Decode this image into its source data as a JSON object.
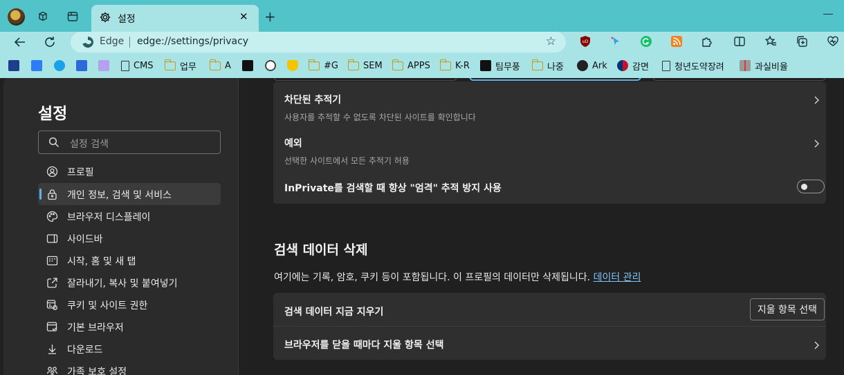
{
  "tab": {
    "title": "설정",
    "close": "✕"
  },
  "newtab": "+",
  "address": {
    "site_label": "Edge",
    "url": "edge://settings/privacy"
  },
  "bookmarks": [
    {
      "label": "CMS",
      "kind": "page"
    },
    {
      "label": "업무",
      "kind": "folder"
    },
    {
      "label": "A",
      "kind": "folder"
    },
    {
      "label": "#G",
      "kind": "folder"
    },
    {
      "label": "SEM",
      "kind": "folder"
    },
    {
      "label": "APPS",
      "kind": "folder"
    },
    {
      "label": "K-R",
      "kind": "folder"
    },
    {
      "label": "팀무풍",
      "kind": "site"
    },
    {
      "label": "나중",
      "kind": "folder"
    },
    {
      "label": "Ark",
      "kind": "site"
    },
    {
      "label": "감면",
      "kind": "site"
    },
    {
      "label": "청년도약장려",
      "kind": "page"
    },
    {
      "label": "과실비율",
      "kind": "site"
    }
  ],
  "sidebar": {
    "title": "설정",
    "search_placeholder": "설정 검색",
    "items": [
      {
        "label": "프로필",
        "icon": "profile-icon"
      },
      {
        "label": "개인 정보, 검색 및 서비스",
        "icon": "lock-icon",
        "active": true
      },
      {
        "label": "브라우저 디스플레이",
        "icon": "palette-icon"
      },
      {
        "label": "사이드바",
        "icon": "sidebar-icon"
      },
      {
        "label": "시작, 홈 및 새 탭",
        "icon": "home-icon"
      },
      {
        "label": "잘라내기, 복사 및 붙여넣기",
        "icon": "share-icon"
      },
      {
        "label": "쿠키 및 사이트 권한",
        "icon": "site-permissions-icon"
      },
      {
        "label": "기본 브라우저",
        "icon": "browser-icon"
      },
      {
        "label": "다운로드",
        "icon": "download-icon"
      },
      {
        "label": "가족 보호 설정",
        "icon": "family-icon"
      }
    ]
  },
  "tracking": {
    "blocked_title": "차단된 추적기",
    "blocked_desc": "사용자를 추적할 수 없도록 차단된 사이트를 확인합니다",
    "exceptions_title": "예외",
    "exceptions_desc": "선택한 사이트에서 모든 추적기 허용",
    "inprivate_title": "InPrivate를 검색할 때 항상 \"엄격\" 추적 방지 사용",
    "inprivate_enabled": false
  },
  "clear": {
    "title": "검색 데이터 삭제",
    "desc": "여기에는 기록, 암호, 쿠키 등이 포함됩니다. 이 프로필의 데이터만 삭제됩니다.",
    "link": "데이터 관리",
    "now_title": "검색 데이터 지금 지우기",
    "choose_button": "지울 항목 선택",
    "on_close_title": "브라우저를 닫을 때마다 지울 항목 선택"
  },
  "colors": {
    "accent": "#5fb4f0",
    "frame": "#52c3c9",
    "toolbar": "#a8e3e6"
  }
}
